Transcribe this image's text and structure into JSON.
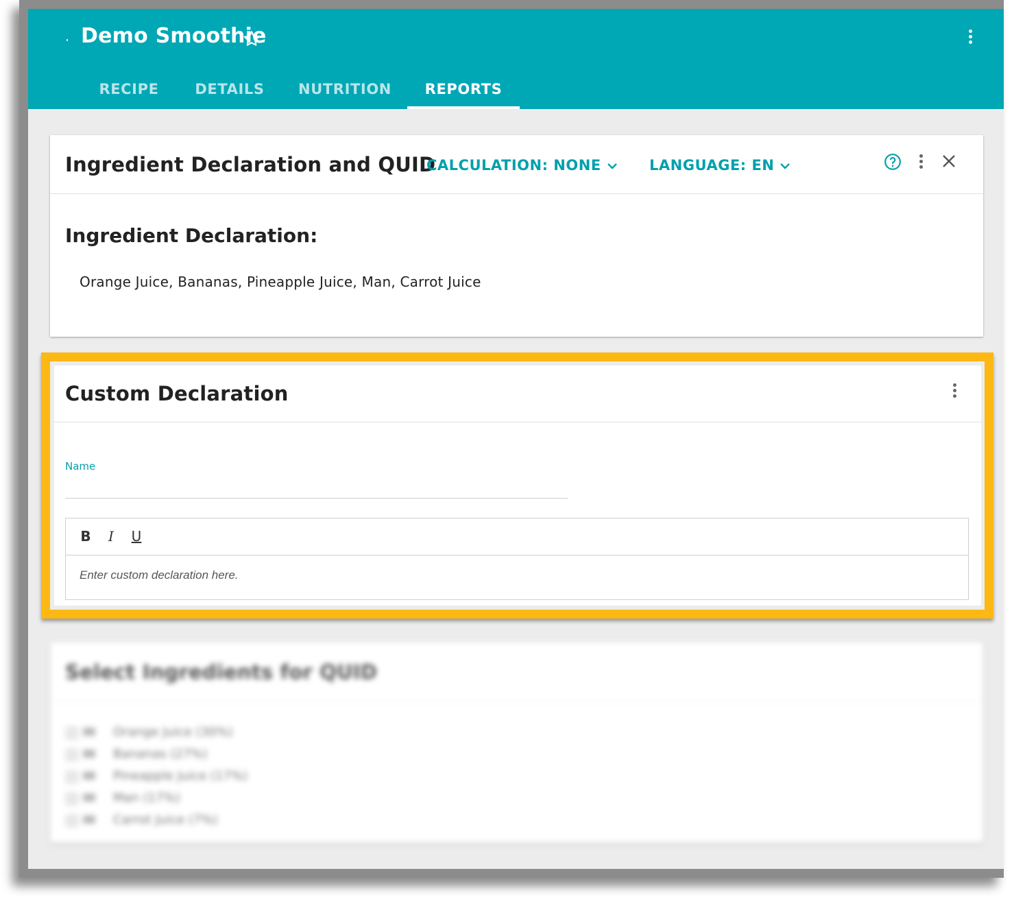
{
  "app": {
    "title": "Demo Smoothie"
  },
  "tabs": [
    {
      "label": "RECIPE",
      "active": false
    },
    {
      "label": "DETAILS",
      "active": false
    },
    {
      "label": "NUTRITION",
      "active": false
    },
    {
      "label": "REPORTS",
      "active": true
    }
  ],
  "ingredient_card": {
    "title": "Ingredient Declaration and QUID",
    "calculation_dropdown": "CALCULATION: NONE",
    "language_dropdown": "LANGUAGE: EN",
    "section_heading": "Ingredient Declaration:",
    "declaration_text": "Orange Juice, Bananas, Pineapple Juice, Man, Carrot Juice"
  },
  "custom_card": {
    "title": "Custom Declaration",
    "name_label": "Name",
    "name_value": "",
    "toolbar": {
      "bold": "B",
      "italic": "I",
      "underline": "U"
    },
    "editor_placeholder": "Enter custom declaration here."
  },
  "quid_card": {
    "title": "Select Ingredients for QUID",
    "items": [
      "Orange Juice (30%)",
      "Bananas (27%)",
      "Pineapple Juice (17%)",
      "Man (17%)",
      "Carrot Juice (7%)"
    ]
  },
  "colors": {
    "brand": "#00a7b5",
    "accent_text": "#00a0ad",
    "highlight": "#fdb813"
  },
  "icons": [
    "star-icon",
    "more-vert-icon",
    "chevron-down-icon",
    "help-icon",
    "close-icon"
  ]
}
